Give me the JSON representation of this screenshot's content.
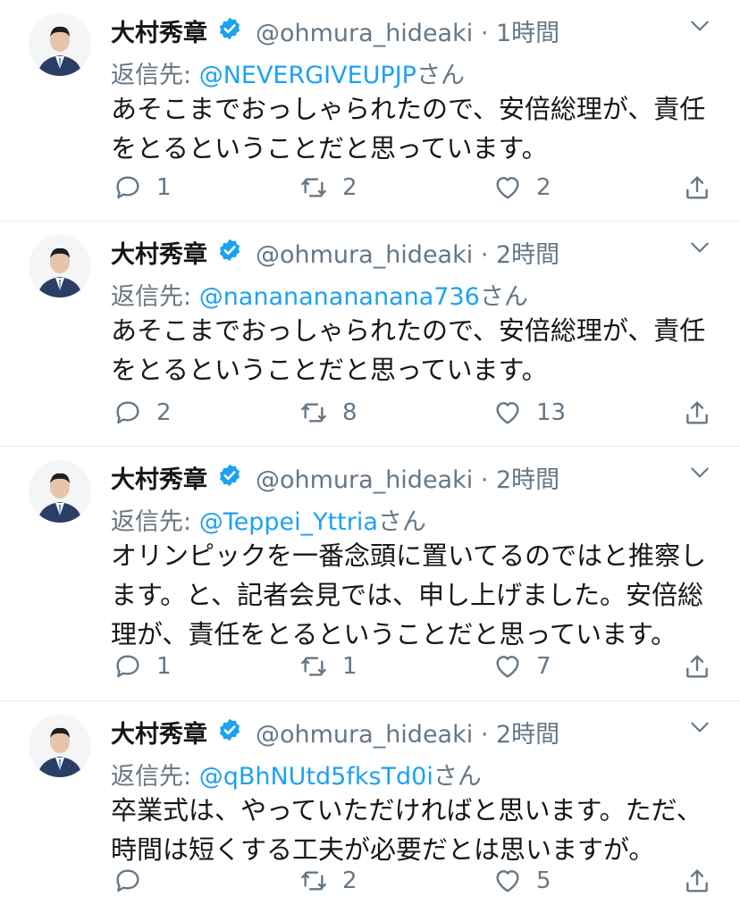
{
  "tweets": [
    {
      "name": "大村秀章",
      "handle": "@ohmura_hideaki",
      "time": "1時間",
      "reply_prefix": "返信先: ",
      "reply_to": "@NEVERGIVEUPJP",
      "reply_suffix": "さん",
      "text": "あそこまでおっしゃられたので、安倍総理が、責任をとるということだと思っています。",
      "replies": "1",
      "retweets": "2",
      "likes": "2"
    },
    {
      "name": "大村秀章",
      "handle": "@ohmura_hideaki",
      "time": "2時間",
      "reply_prefix": "返信先: ",
      "reply_to": "@nanananananana736",
      "reply_suffix": "さん",
      "text": "あそこまでおっしゃられたので、安倍総理が、責任をとるということだと思っています。",
      "replies": "2",
      "retweets": "8",
      "likes": "13"
    },
    {
      "name": "大村秀章",
      "handle": "@ohmura_hideaki",
      "time": "2時間",
      "reply_prefix": "返信先: ",
      "reply_to": "@Teppei_Yttria",
      "reply_suffix": "さん",
      "text": "オリンピックを一番念頭に置いてるのではと推察します。と、記者会見では、申し上げました。安倍総理が、責任をとるということだと思っています。",
      "replies": "1",
      "retweets": "1",
      "likes": "7"
    },
    {
      "name": "大村秀章",
      "handle": "@ohmura_hideaki",
      "time": "2時間",
      "reply_prefix": "返信先: ",
      "reply_to": "@qBhNUtd5fksTd0i",
      "reply_suffix": "さん",
      "text": "卒業式は、やっていただければと思います。ただ、時間は短くする工夫が必要だとは思いますが。",
      "replies": "",
      "retweets": "2",
      "likes": "5"
    }
  ],
  "icons": {
    "verified": "verified-badge-icon",
    "more": "chevron-down-icon",
    "reply": "reply-icon",
    "retweet": "retweet-icon",
    "like": "heart-icon",
    "share": "share-icon"
  },
  "colors": {
    "accent": "#1da1f2",
    "muted": "#657786",
    "text": "#14171a",
    "divider": "#e6ecf0"
  }
}
